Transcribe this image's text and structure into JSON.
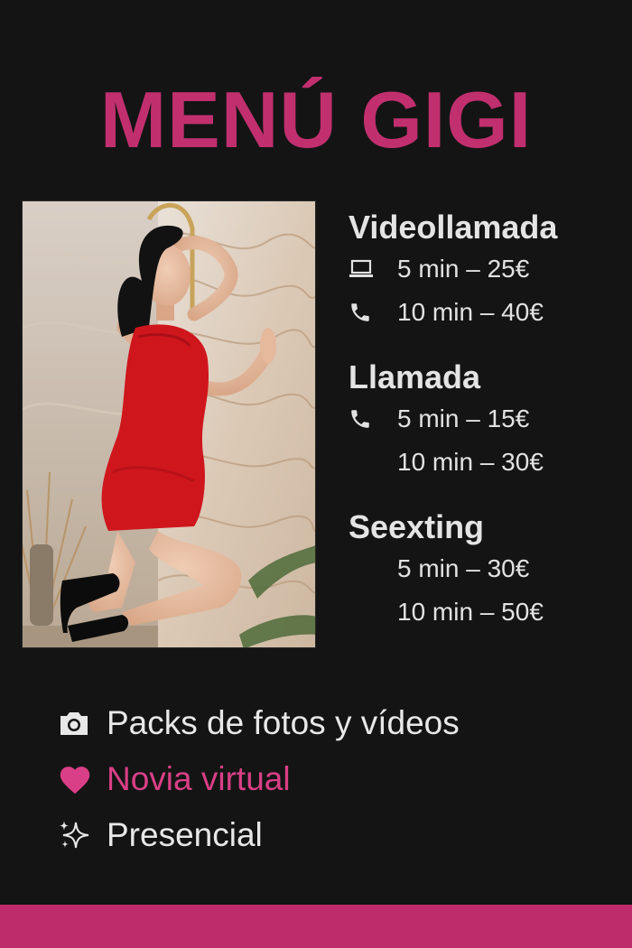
{
  "title": "MENÚ GIGI",
  "photo": {
    "alt": "Woman in red dress"
  },
  "services": [
    {
      "heading": "Videollamada",
      "rows": [
        {
          "icon": "laptop-icon",
          "text": "5 min – 25€"
        },
        {
          "icon": "phone-icon",
          "text": "10 min – 40€"
        }
      ]
    },
    {
      "heading": "Llamada",
      "rows": [
        {
          "icon": "phone-icon",
          "text": "5 min – 15€"
        },
        {
          "icon": "",
          "text": "10 min – 30€"
        }
      ]
    },
    {
      "heading": "Seexting",
      "rows": [
        {
          "icon": "",
          "text": "5 min – 30€"
        },
        {
          "icon": "",
          "text": "10 min – 50€"
        }
      ]
    }
  ],
  "extras": [
    {
      "icon": "camera-icon",
      "label": "Packs de fotos y vídeos"
    },
    {
      "icon": "heart-icon",
      "label": "Novia virtual"
    },
    {
      "icon": "sparkles-icon",
      "label": "Presencial"
    }
  ],
  "colors": {
    "accent": "#c12f6f",
    "background": "#141414",
    "text": "#e6e6e6",
    "dress": "#d0161d"
  }
}
